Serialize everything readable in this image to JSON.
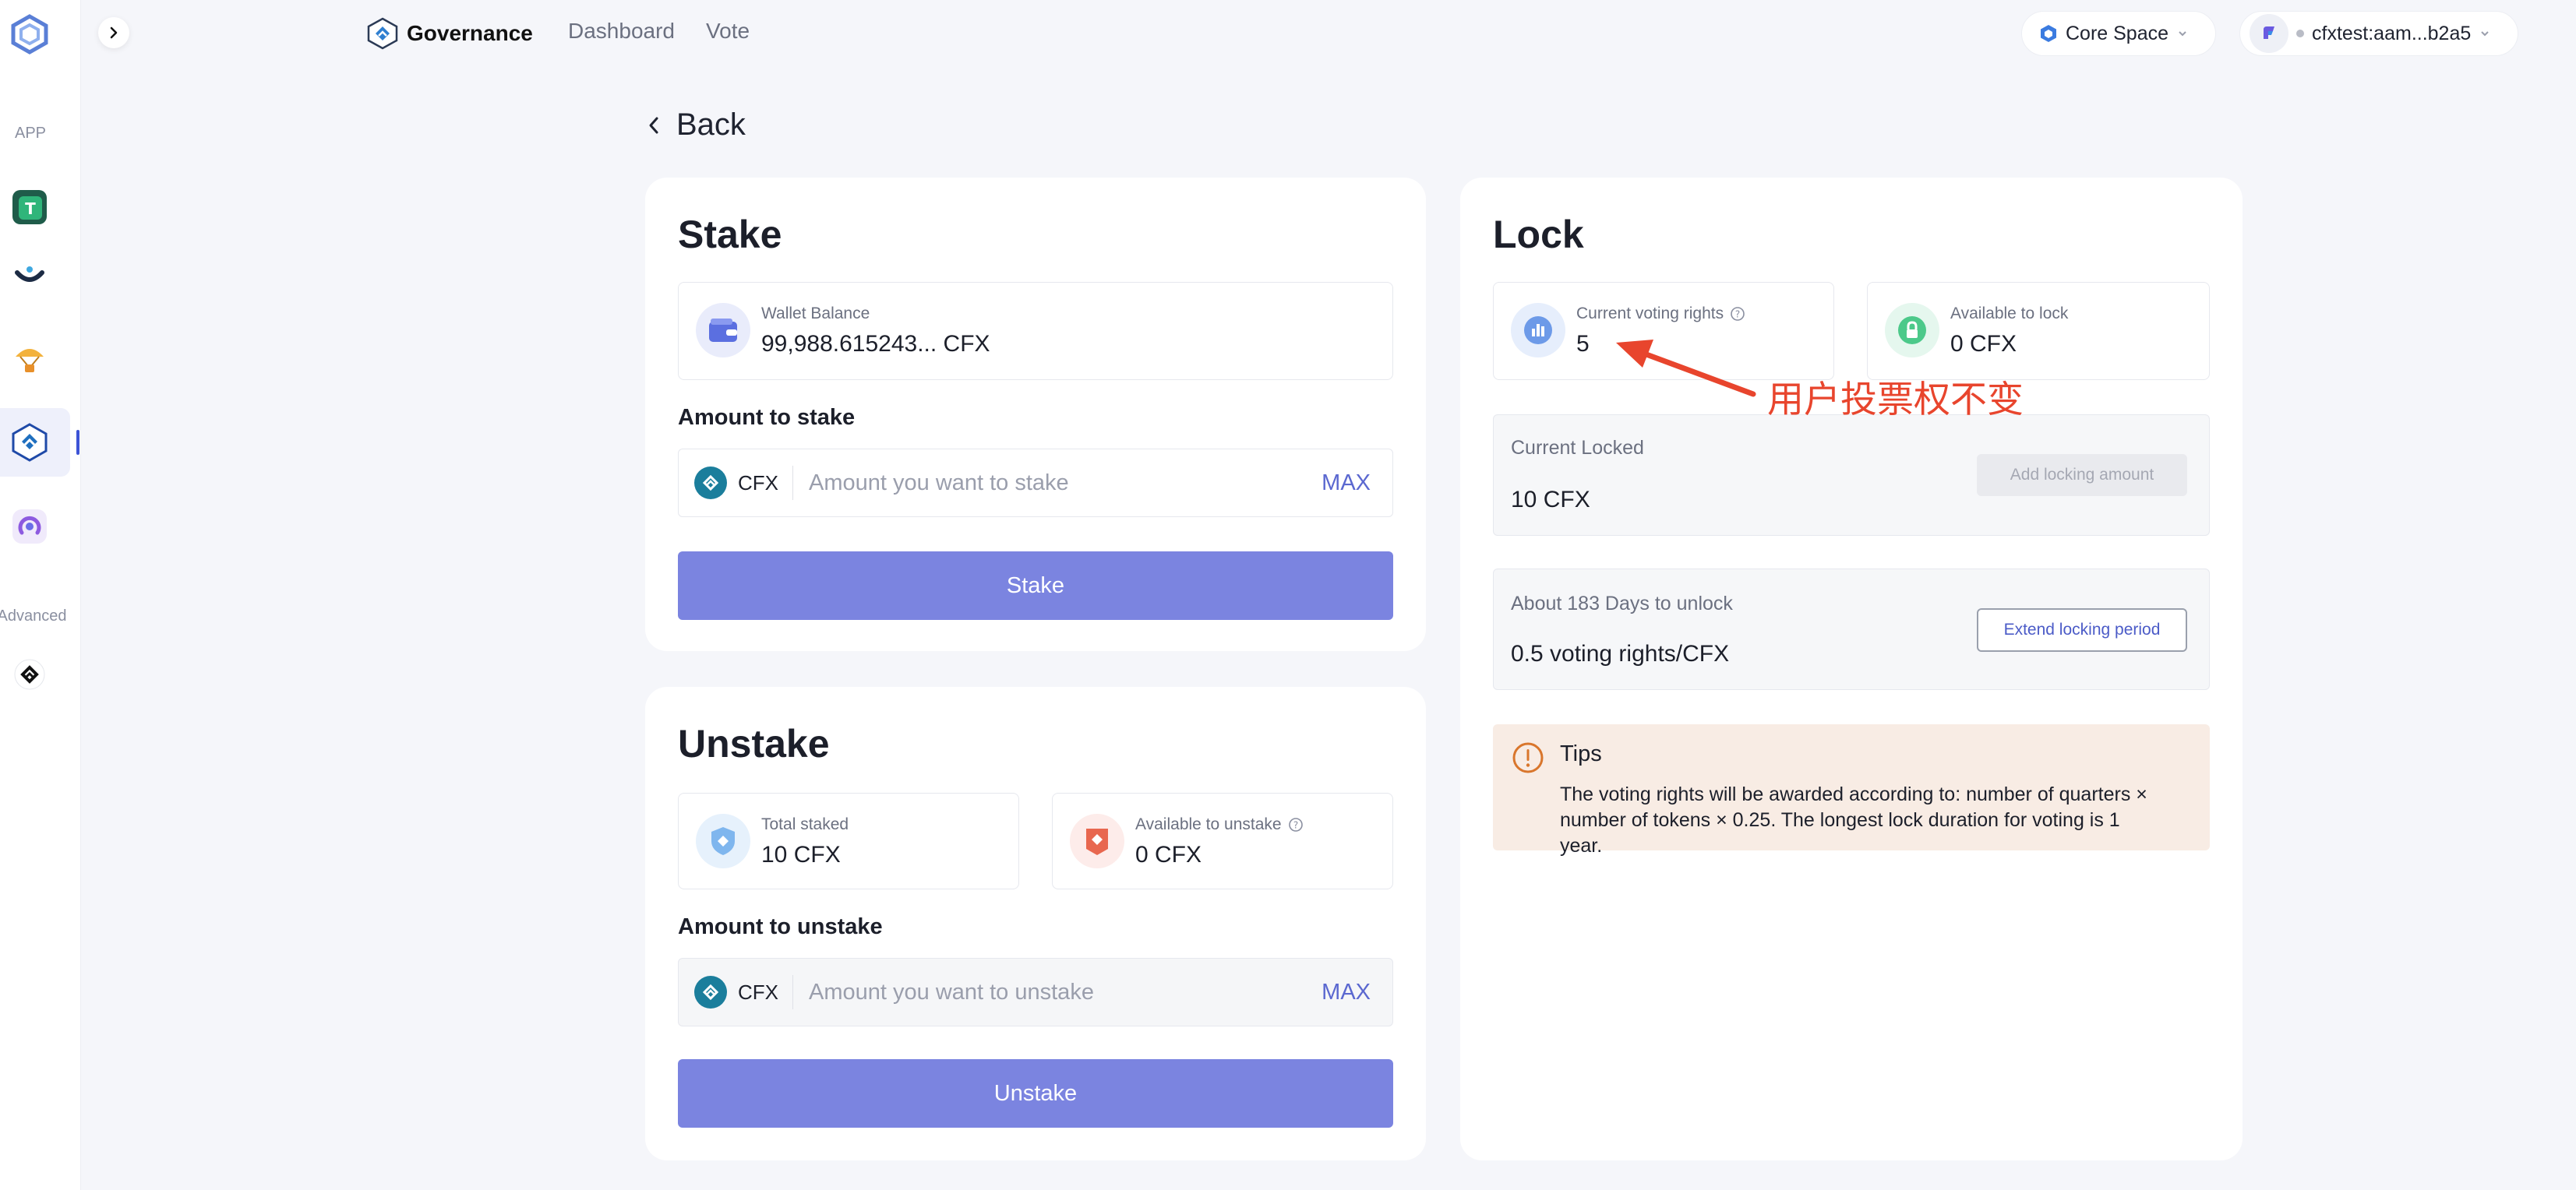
{
  "sidebar": {
    "section_app": "APP",
    "section_advanced": "Advanced",
    "apps": [
      "token-app-icon",
      "wallet-app-icon",
      "airdrop-app-icon",
      "governance-app-icon",
      "pos-app-icon"
    ],
    "advanced_apps": [
      "governance-advanced-icon"
    ]
  },
  "header": {
    "brand": "Governance",
    "nav": [
      "Dashboard",
      "Vote"
    ],
    "network": "Core Space",
    "account": "cfxtest:aam...b2a5"
  },
  "back_label": "Back",
  "stake": {
    "title": "Stake",
    "wallet_balance_label": "Wallet Balance",
    "wallet_balance_value": "99,988.615243... CFX",
    "amount_label": "Amount to stake",
    "token": "CFX",
    "placeholder": "Amount you want to stake",
    "max": "MAX",
    "button": "Stake"
  },
  "unstake": {
    "title": "Unstake",
    "total_staked_label": "Total staked",
    "total_staked_value": "10 CFX",
    "available_label": "Available to unstake",
    "available_value": "0 CFX",
    "amount_label": "Amount to unstake",
    "token": "CFX",
    "placeholder": "Amount you want to unstake",
    "max": "MAX",
    "button": "Unstake"
  },
  "lock": {
    "title": "Lock",
    "voting_rights_label": "Current voting rights",
    "voting_rights_value": "5",
    "available_label": "Available to lock",
    "available_value": "0 CFX",
    "current_locked_label": "Current Locked",
    "current_locked_value": "10 CFX",
    "add_button": "Add locking amount",
    "unlock_label": "About 183 Days to unlock",
    "rate_value": "0.5 voting rights/CFX",
    "extend_button": "Extend locking period",
    "tips_title": "Tips",
    "tips_text": "The voting rights will be awarded according to: number of quarters × number of tokens × 0.25. The longest lock duration for voting is 1 year."
  },
  "annotation": "用户投票权不变",
  "colors": {
    "primary": "#7b84e0",
    "accent": "#5b68d0",
    "annotation": "#e8452d",
    "tips_bg": "#f8ece4"
  }
}
